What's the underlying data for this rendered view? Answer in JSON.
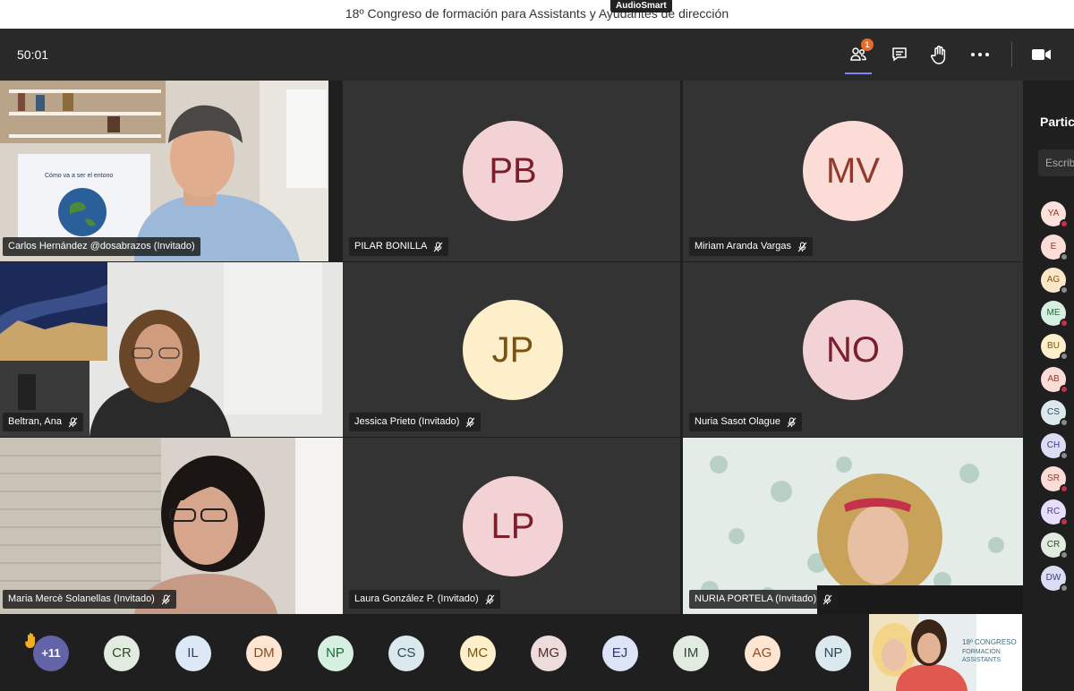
{
  "window": {
    "title": "18º Congreso de formación para Assistants y Ayudantes de dirección",
    "overlay_badge": "AudioSmart"
  },
  "toolbar": {
    "timer": "50:01",
    "participants_icon": "people-icon",
    "participants_count": "1",
    "chat_icon": "chat-icon",
    "hand_icon": "raise-hand-icon",
    "more_icon": "more-icon",
    "camera_icon": "video-camera-icon"
  },
  "tiles": [
    {
      "name": "Carlos Hernández @dosabrazos (Invitado)",
      "type": "video",
      "muted": false
    },
    {
      "name": "PILAR BONILLA",
      "type": "avatar",
      "initials": "PB",
      "bg": "#f3d2d6",
      "fg": "#7a1f2b",
      "muted": true
    },
    {
      "name": "Miriam Aranda Vargas",
      "type": "avatar",
      "initials": "MV",
      "bg": "#fcdcd6",
      "fg": "#8e3b2b",
      "muted": true
    },
    {
      "name": "Beltran, Ana",
      "type": "video",
      "muted": true
    },
    {
      "name": "Jessica Prieto (Invitado)",
      "type": "avatar",
      "initials": "JP",
      "bg": "#fcefc9",
      "fg": "#7a5312",
      "muted": true
    },
    {
      "name": "Nuria Sasot Olague",
      "type": "avatar",
      "initials": "NO",
      "bg": "#f3d2d6",
      "fg": "#7a1f2b",
      "muted": true
    },
    {
      "name": "Maria Mercè Solanellas (Invitado)",
      "type": "video",
      "muted": true
    },
    {
      "name": "Laura González P. (Invitado)",
      "type": "avatar",
      "initials": "LP",
      "bg": "#f3d2d6",
      "fg": "#7a1f2b",
      "muted": true
    },
    {
      "name": "NURIA PORTELA (Invitado)",
      "type": "video",
      "muted": true
    }
  ],
  "video_scene": {
    "slide_caption": "Cómo va a ser el entono"
  },
  "panel": {
    "title": "Participantes",
    "search_placeholder": "Escribir",
    "avatars": [
      {
        "initials": "YA",
        "bg": "#fce1dc",
        "fg": "#8e3b2b",
        "status": "#c4314b"
      },
      {
        "initials": "E",
        "bg": "#fcdcd6",
        "fg": "#8e3b2b",
        "status": "#8a8a8a"
      },
      {
        "initials": "AG",
        "bg": "#fbe6c8",
        "fg": "#7a5312",
        "status": "#8a8a8a"
      },
      {
        "initials": "ME",
        "bg": "#d5f0e0",
        "fg": "#1e6b3a",
        "status": "#c4314b"
      },
      {
        "initials": "BU",
        "bg": "#fcefc9",
        "fg": "#7a5312",
        "status": "#8a8a8a"
      },
      {
        "initials": "AB",
        "bg": "#fcdcd6",
        "fg": "#8e3b2b",
        "status": "#c4314b"
      },
      {
        "initials": "CS",
        "bg": "#dbe8ee",
        "fg": "#2b4a5a",
        "status": "#8a8a8a"
      },
      {
        "initials": "CH",
        "bg": "#dcdcf4",
        "fg": "#3b3b8e",
        "status": "#8a8a8a"
      },
      {
        "initials": "SR",
        "bg": "#fcdcd6",
        "fg": "#8e3b2b",
        "status": "#c4314b"
      },
      {
        "initials": "RC",
        "bg": "#e6defa",
        "fg": "#4b3b8e",
        "status": "#c4314b"
      },
      {
        "initials": "CR",
        "bg": "#e2ebe0",
        "fg": "#2e4a2b",
        "status": "#8a8a8a"
      },
      {
        "initials": "DW",
        "bg": "#dcdcf4",
        "fg": "#3b3b8e",
        "status": "#8a8a8a"
      }
    ]
  },
  "strip": {
    "more_label": "+11",
    "hand_icon": "raised-hand-icon",
    "avatars": [
      {
        "initials": "CR",
        "bg": "#e2ebe0",
        "fg": "#2e4a2b"
      },
      {
        "initials": "IL",
        "bg": "#dce8f6",
        "fg": "#1f4a7a"
      },
      {
        "initials": "DM",
        "bg": "#fde5d2",
        "fg": "#8e4b1f"
      },
      {
        "initials": "NP",
        "bg": "#d5f0e0",
        "fg": "#1e6b3a"
      },
      {
        "initials": "CS",
        "bg": "#dbe8ee",
        "fg": "#2b4a5a"
      },
      {
        "initials": "MC",
        "bg": "#fcefc9",
        "fg": "#7a5312"
      },
      {
        "initials": "MG",
        "bg": "#ecdcdc",
        "fg": "#5a2b2b"
      },
      {
        "initials": "EJ",
        "bg": "#dce4f6",
        "fg": "#2b3b7a"
      },
      {
        "initials": "IM",
        "bg": "#e2ebe0",
        "fg": "#2e4a2b"
      },
      {
        "initials": "AG",
        "bg": "#fde5d2",
        "fg": "#8e4b1f"
      },
      {
        "initials": "NP",
        "bg": "#dbe8ee",
        "fg": "#2b4a5a"
      }
    ],
    "selfview_texts": [
      "18º CONGRESO",
      "FORMACIÓN",
      "ASSISTANTS"
    ]
  },
  "colors": {
    "accent": "#6264a7",
    "notification": "#e86b2c",
    "muted_status": "#c4314b"
  }
}
